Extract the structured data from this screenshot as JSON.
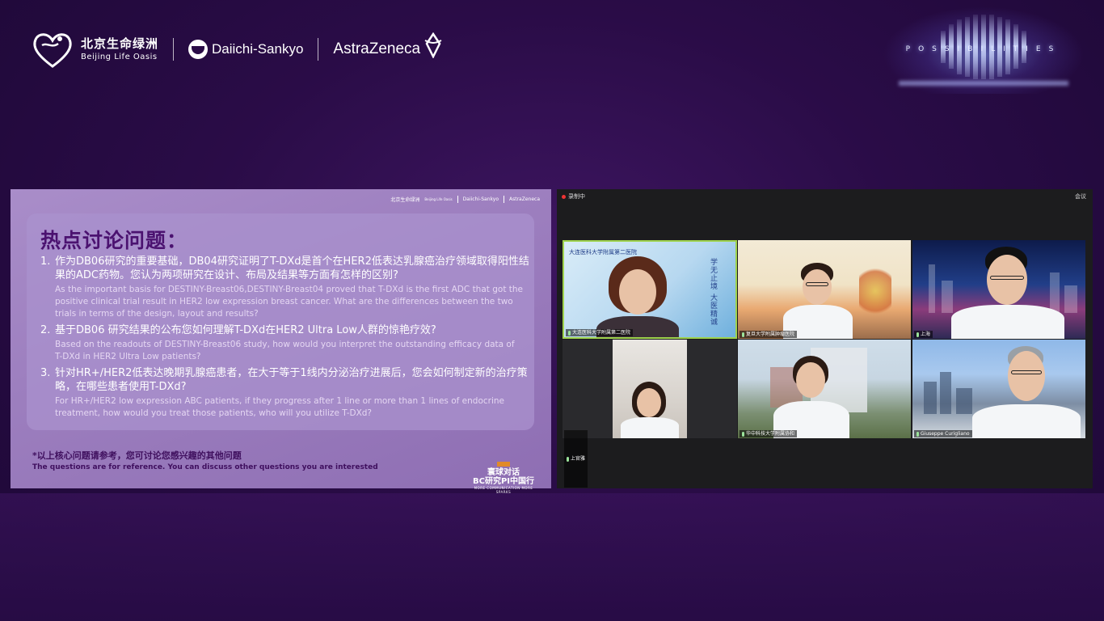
{
  "branding": {
    "oasis_cn": "北京生命绿洲",
    "oasis_en": "Beijing Life Oasis",
    "daiichi": "Daiichi-Sankyo",
    "astrazeneca": "AstraZeneca"
  },
  "possibilities": {
    "text": "POSSIBILITIES"
  },
  "slide": {
    "logos": {
      "oasis": "北京生命绿洲",
      "oasis_sub": "Beijing Life Oasis",
      "daiichi": "Daiichi-Sankyo",
      "astrazeneca": "AstraZeneca"
    },
    "title": "热点讨论问题：",
    "questions": [
      {
        "num": "1.",
        "cn": "作为DB06研究的重要基础，DB04研究证明了T-DXd是首个在HER2低表达乳腺癌治疗领域取得阳性结果的ADC药物。您认为两项研究在设计、布局及结果等方面有怎样的区别?",
        "en": "As the important basis for DESTINY-Breast06,DESTINY-Breast04 proved that T-DXd is the first ADC that got the positive clinical trial result in HER2 low expression breast cancer. What are the differences between the two trials in terms of the design, layout and results?"
      },
      {
        "num": "2.",
        "cn": "基于DB06 研究结果的公布您如何理解T-DXd在HER2 Ultra Low人群的惊艳疗效?",
        "en": "Based on the readouts of DESTINY-Breast06 study, how would you interpret the outstanding efficacy data of T-DXd in HER2 Ultra Low patients?"
      },
      {
        "num": "3.",
        "cn": "针对HR+/HER2低表达晚期乳腺癌患者，在大于等于1线内分泌治疗进展后，您会如何制定新的治疗策略，在哪些患者使用T-DXd?",
        "en": "For HR+/HER2 low expression ABC patients, if they progress after 1 line or more than 1 lines of endocrine treatment, how would you treat those patients, who will you utilize T-DXd?"
      }
    ],
    "footnote_cn": "*以上核心问题请参考，您可讨论您感兴趣的其他问题",
    "footnote_en": "The questions are for reference. You can discuss other questions you are interested",
    "badge": {
      "line1": "寰球对话",
      "line2": "BC研究PI中国行",
      "sub": "MORE COMMUNICATION MORE SPARKS"
    }
  },
  "conference": {
    "recording_label": "录制中",
    "menu_label": "会议",
    "participants": [
      {
        "name": "大连医科大学附属第二医院"
      },
      {
        "name": "复旦大学附属肿瘤医院"
      },
      {
        "name": "上海"
      },
      {
        "name": "上官雅"
      },
      {
        "name": "华中科技大学附属协和"
      },
      {
        "name": "Giuseppe Curigliano"
      }
    ],
    "tile1_text": "大连医科大学附属第二医院",
    "tile1_vertical": "学无止境 大医精诚"
  },
  "colors": {
    "background": "#2a0c47",
    "slide_bg": "#a98dc9",
    "title": "#4b1270",
    "active_speaker_border": "#9fd34d",
    "rec_dot": "#e33333"
  }
}
